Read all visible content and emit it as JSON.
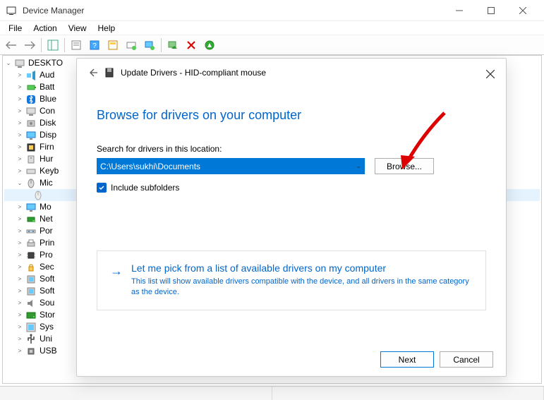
{
  "window": {
    "title": "Device Manager"
  },
  "menu": {
    "items": [
      "File",
      "Action",
      "View",
      "Help"
    ]
  },
  "tree": {
    "root": "DESKTO",
    "items": [
      {
        "label": "Aud",
        "icon": "audio"
      },
      {
        "label": "Batt",
        "icon": "battery"
      },
      {
        "label": "Blue",
        "icon": "bluetooth"
      },
      {
        "label": "Con",
        "icon": "computer"
      },
      {
        "label": "Disk",
        "icon": "disk"
      },
      {
        "label": "Disp",
        "icon": "display"
      },
      {
        "label": "Firn",
        "icon": "firmware"
      },
      {
        "label": "Hur",
        "icon": "hid"
      },
      {
        "label": "Keyb",
        "icon": "keyboard"
      },
      {
        "label": "Mic",
        "icon": "mouse",
        "expanded": true,
        "children": [
          {
            "label": "",
            "icon": "mouse-child",
            "highlighted": true
          }
        ]
      },
      {
        "label": "Mo",
        "icon": "monitor"
      },
      {
        "label": "Net",
        "icon": "network"
      },
      {
        "label": "Por",
        "icon": "ports"
      },
      {
        "label": "Prin",
        "icon": "printer"
      },
      {
        "label": "Pro",
        "icon": "processor"
      },
      {
        "label": "Sec",
        "icon": "security"
      },
      {
        "label": "Soft",
        "icon": "software"
      },
      {
        "label": "Soft",
        "icon": "software"
      },
      {
        "label": "Sou",
        "icon": "sound"
      },
      {
        "label": "Stor",
        "icon": "storage"
      },
      {
        "label": "Sys",
        "icon": "system"
      },
      {
        "label": "Uni",
        "icon": "usb"
      },
      {
        "label": "USB",
        "icon": "usb-connector"
      }
    ]
  },
  "dialog": {
    "title": "Update Drivers - HID-compliant mouse",
    "heading": "Browse for drivers on your computer",
    "search_label": "Search for drivers in this location:",
    "path_value": "C:\\Users\\sukhi\\Documents",
    "browse_label": "Browse...",
    "include_subfolders": "Include subfolders",
    "option_card": {
      "title": "Let me pick from a list of available drivers on my computer",
      "desc": "This list will show available drivers compatible with the device, and all drivers in the same category as the device."
    },
    "footer": {
      "next": "Next",
      "cancel": "Cancel"
    }
  }
}
